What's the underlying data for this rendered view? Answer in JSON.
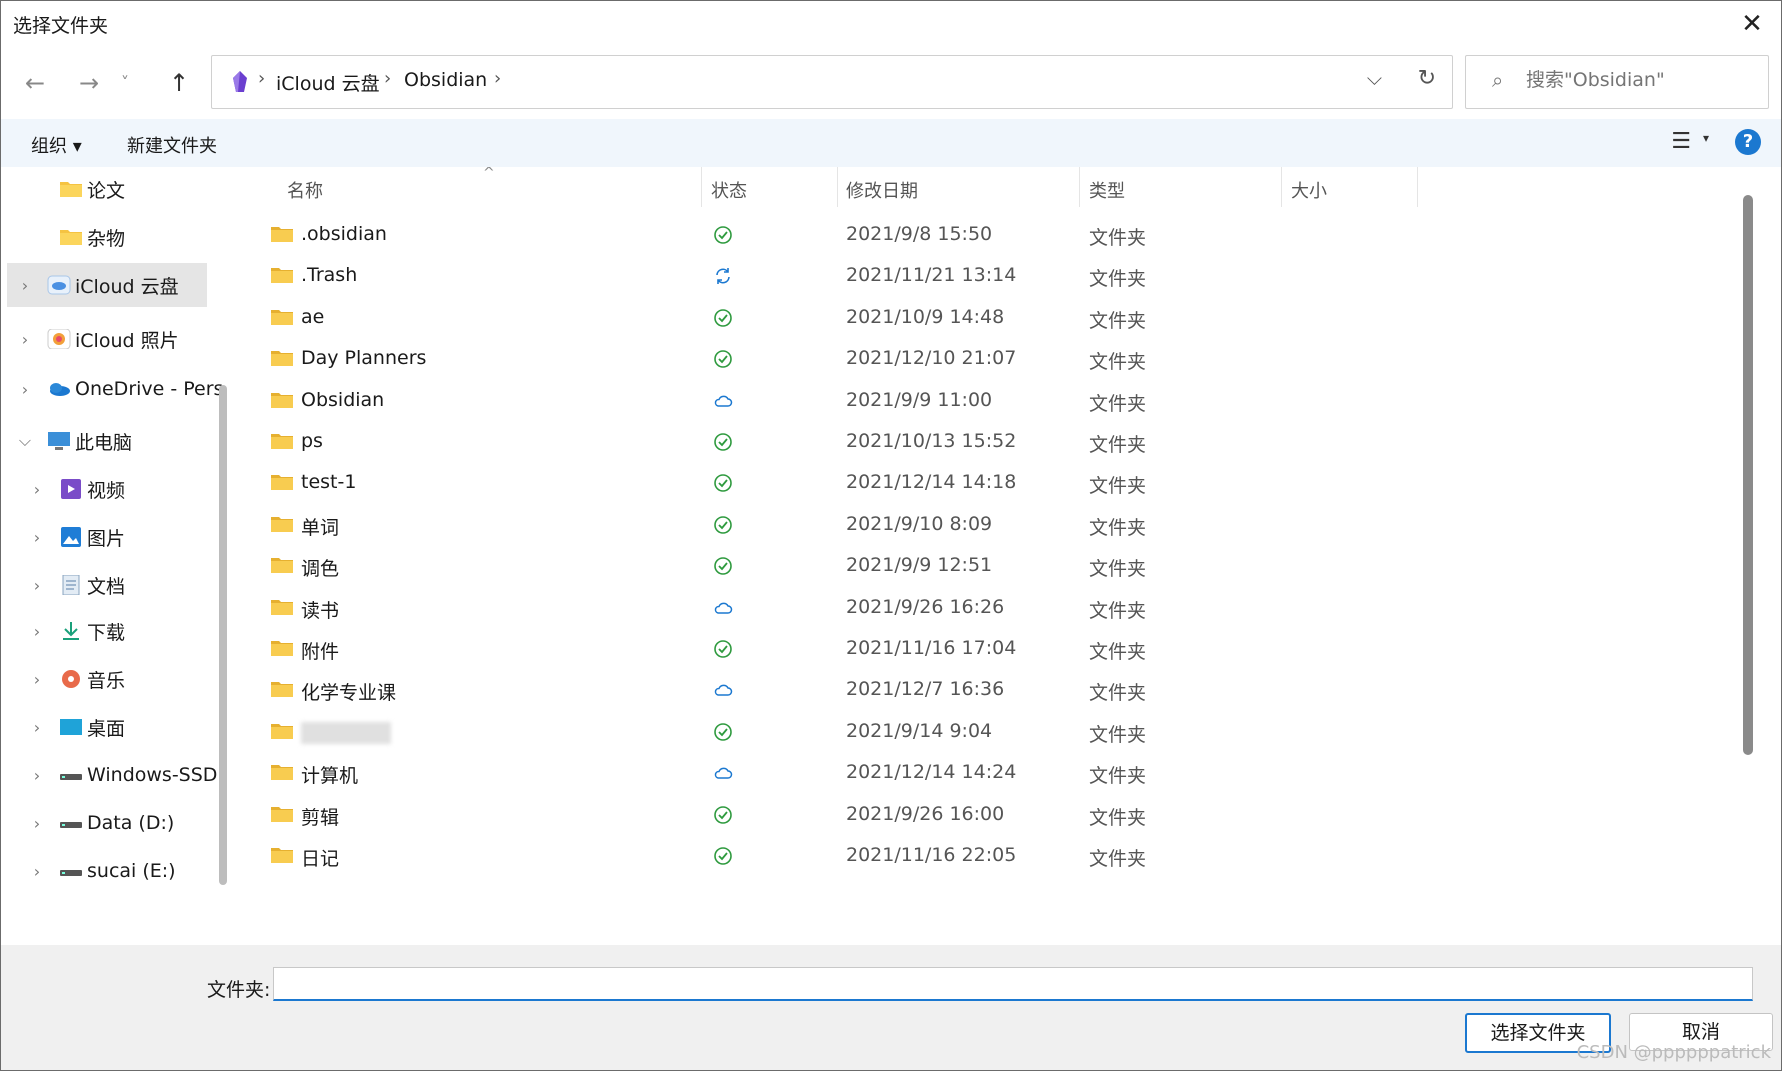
{
  "window": {
    "title": "选择文件夹",
    "close": "✕"
  },
  "nav": {
    "back": "←",
    "forward": "→",
    "recent": "˅",
    "up": "↑"
  },
  "address": {
    "crumbs": [
      "iCloud 云盘",
      "Obsidian"
    ],
    "separator": "›",
    "dropdown": "⌵",
    "refresh": "↻"
  },
  "search": {
    "placeholder": "搜索\"Obsidian\""
  },
  "toolbar": {
    "organize": "组织 ▾",
    "new_folder": "新建文件夹",
    "view": "☰",
    "view_dd": "▾",
    "help": "?"
  },
  "sidebar": {
    "items": [
      {
        "label": "论文",
        "icon": "folder-icon",
        "level": 2,
        "chevron": ""
      },
      {
        "label": "杂物",
        "icon": "folder-icon",
        "level": 2,
        "chevron": ""
      },
      {
        "label": "iCloud 云盘",
        "icon": "icloud-drive-icon",
        "level": 1,
        "chevron": "›",
        "selected": true
      },
      {
        "label": "iCloud 照片",
        "icon": "icloud-photos-icon",
        "level": 1,
        "chevron": "›"
      },
      {
        "label": "OneDrive - Pers",
        "icon": "onedrive-icon",
        "level": 1,
        "chevron": "›"
      },
      {
        "label": "此电脑",
        "icon": "computer-icon",
        "level": 1,
        "chevron": "⌵"
      },
      {
        "label": "视频",
        "icon": "videos-icon",
        "level": 2,
        "chevron": "›"
      },
      {
        "label": "图片",
        "icon": "pictures-icon",
        "level": 2,
        "chevron": "›"
      },
      {
        "label": "文档",
        "icon": "documents-icon",
        "level": 2,
        "chevron": "›"
      },
      {
        "label": "下载",
        "icon": "downloads-icon",
        "level": 2,
        "chevron": "›"
      },
      {
        "label": "音乐",
        "icon": "music-icon",
        "level": 2,
        "chevron": "›"
      },
      {
        "label": "桌面",
        "icon": "desktop-icon",
        "level": 2,
        "chevron": "›"
      },
      {
        "label": "Windows-SSD",
        "icon": "drive-icon",
        "level": 2,
        "chevron": "›"
      },
      {
        "label": "Data (D:)",
        "icon": "drive-icon",
        "level": 2,
        "chevron": "›"
      },
      {
        "label": "sucai (E:)",
        "icon": "drive-icon",
        "level": 2,
        "chevron": "›"
      }
    ]
  },
  "columns": {
    "name": "名称",
    "status": "状态",
    "modified": "修改日期",
    "type": "类型",
    "size": "大小",
    "sort_indicator": "^"
  },
  "files": [
    {
      "name": ".obsidian",
      "status": "synced",
      "date": "2021/9/8 15:50",
      "type": "文件夹"
    },
    {
      "name": ".Trash",
      "status": "syncing",
      "date": "2021/11/21 13:14",
      "type": "文件夹"
    },
    {
      "name": "ae",
      "status": "synced",
      "date": "2021/10/9 14:48",
      "type": "文件夹"
    },
    {
      "name": "Day Planners",
      "status": "synced",
      "date": "2021/12/10 21:07",
      "type": "文件夹"
    },
    {
      "name": "Obsidian",
      "status": "cloud",
      "date": "2021/9/9 11:00",
      "type": "文件夹"
    },
    {
      "name": "ps",
      "status": "synced",
      "date": "2021/10/13 15:52",
      "type": "文件夹"
    },
    {
      "name": "test-1",
      "status": "synced",
      "date": "2021/12/14 14:18",
      "type": "文件夹"
    },
    {
      "name": "单词",
      "status": "synced",
      "date": "2021/9/10 8:09",
      "type": "文件夹"
    },
    {
      "name": "调色",
      "status": "synced",
      "date": "2021/9/9 12:51",
      "type": "文件夹"
    },
    {
      "name": "读书",
      "status": "cloud",
      "date": "2021/9/26 16:26",
      "type": "文件夹"
    },
    {
      "name": "附件",
      "status": "synced",
      "date": "2021/11/16 17:04",
      "type": "文件夹"
    },
    {
      "name": "化学专业课",
      "status": "cloud",
      "date": "2021/12/7 16:36",
      "type": "文件夹"
    },
    {
      "name": "",
      "status": "synced",
      "date": "2021/9/14 9:04",
      "type": "文件夹",
      "blurred": true
    },
    {
      "name": "计算机",
      "status": "cloud",
      "date": "2021/12/14 14:24",
      "type": "文件夹"
    },
    {
      "name": "剪辑",
      "status": "synced",
      "date": "2021/9/26 16:00",
      "type": "文件夹"
    },
    {
      "name": "日记",
      "status": "synced",
      "date": "2021/11/16 22:05",
      "type": "文件夹"
    }
  ],
  "footer": {
    "folder_label": "文件夹:",
    "folder_value": "",
    "select_button": "选择文件夹",
    "cancel_button": "取消",
    "watermark": "CSDN @ppppppatrick"
  },
  "colors": {
    "accent": "#1b78d0",
    "synced": "#2e9a3e",
    "cloud": "#1b78d0",
    "folder": "#f5c342"
  }
}
